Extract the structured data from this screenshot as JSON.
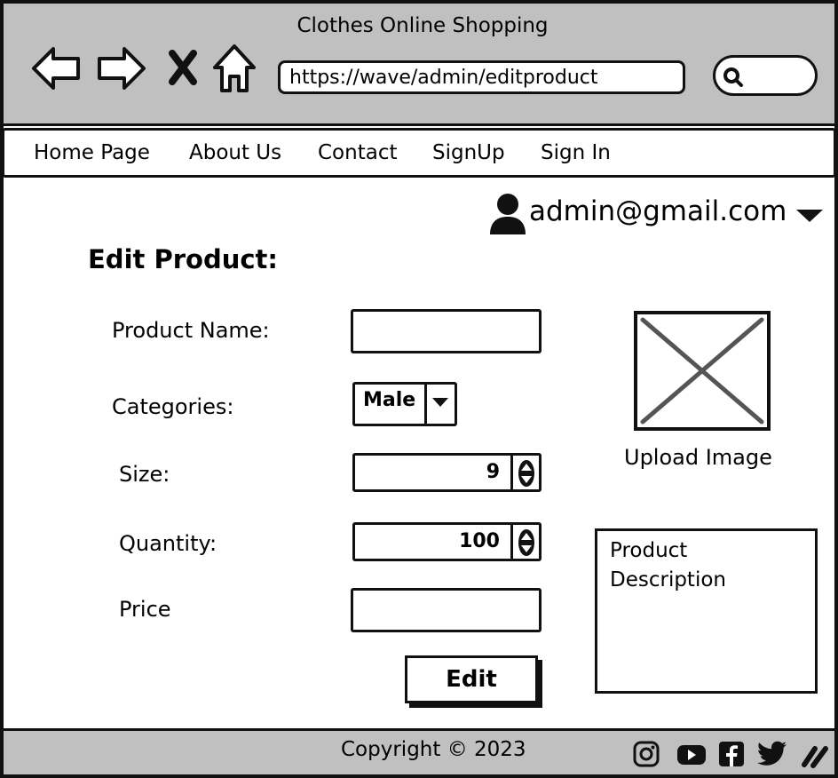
{
  "window": {
    "title": "Clothes Online Shopping"
  },
  "browser": {
    "url": "https://wave/admin/editproduct",
    "icons": [
      "back-arrow-icon",
      "forward-arrow-icon",
      "close-x-icon",
      "home-icon",
      "search-icon"
    ]
  },
  "nav": {
    "items": [
      {
        "label": "Home Page"
      },
      {
        "label": "About Us"
      },
      {
        "label": "Contact"
      },
      {
        "label": "SignUp"
      },
      {
        "label": "Sign In"
      }
    ]
  },
  "user": {
    "email": "admin@gmail.com",
    "icon": "user-icon"
  },
  "page": {
    "title": "Edit Product:"
  },
  "form": {
    "product_name_label": "Product Name:",
    "product_name_value": "",
    "categories_label": "Categories:",
    "categories_value": "Male",
    "size_label": "Size:",
    "size_value": "9",
    "quantity_label": "Quantity:",
    "quantity_value": "100",
    "price_label": "Price",
    "price_value": "",
    "edit_label": "Edit"
  },
  "image": {
    "upload_label": "Upload Image"
  },
  "description": {
    "text": "Product Description"
  },
  "footer": {
    "copyright": "Copyright © 2023",
    "social_icons": [
      "instagram-icon",
      "youtube-icon",
      "facebook-icon",
      "twitter-icon",
      "edit-pen-icon"
    ]
  },
  "colors": {
    "chrome": "#c0c0c0",
    "ink": "#111111",
    "placeholder_x": "#555555"
  }
}
